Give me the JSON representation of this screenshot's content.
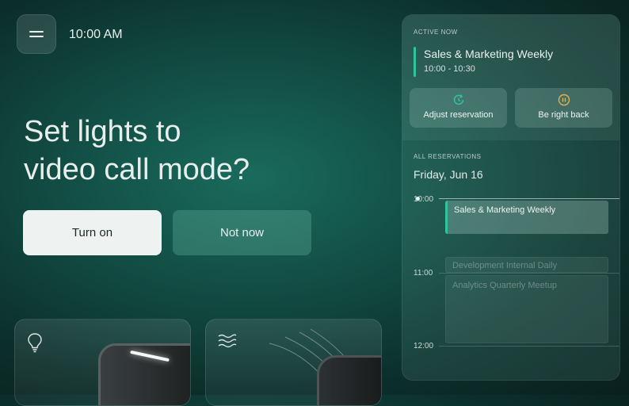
{
  "header": {
    "clock": "10:00 AM",
    "menu_icon": "hamburger-icon"
  },
  "prompt": {
    "headline_line1": "Set lights to",
    "headline_line2": "video call mode?",
    "turn_on_label": "Turn on",
    "not_now_label": "Not now"
  },
  "cards": [
    {
      "name": "lights",
      "icon": "lightbulb-icon"
    },
    {
      "name": "climate",
      "icon": "waves-icon"
    }
  ],
  "panel": {
    "active_label": "ACTIVE NOW",
    "active_meeting": {
      "title": "Sales & Marketing Weekly",
      "time": "10:00 - 10:30",
      "accent_color": "#2fc59a"
    },
    "adjust_label": "Adjust reservation",
    "adjust_icon": "refresh-clock-icon",
    "brb_label": "Be right back",
    "brb_icon": "pause-circle-icon",
    "brb_icon_color": "#e6b24a",
    "all_label": "ALL RESERVATIONS",
    "date": "Friday, Jun 16",
    "times": [
      "10:00",
      "11:00",
      "12:00"
    ],
    "reservations": [
      {
        "title": "Sales & Marketing Weekly",
        "state": "active"
      },
      {
        "title": "Development Internal Daily",
        "state": "upcoming"
      },
      {
        "title": "Analytics Quarterly Meetup",
        "state": "upcoming"
      }
    ]
  }
}
